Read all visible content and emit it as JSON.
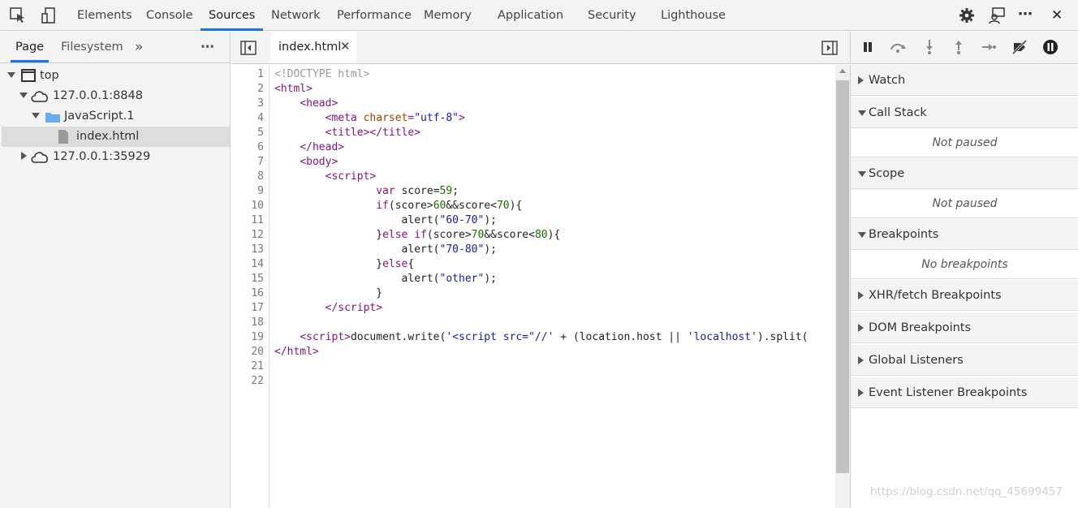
{
  "toolbar": {
    "tabs": [
      {
        "label": "Elements"
      },
      {
        "label": "Console"
      },
      {
        "label": "Sources"
      },
      {
        "label": "Network"
      },
      {
        "label": "Performance"
      },
      {
        "label": "Memory"
      },
      {
        "label": "Application"
      },
      {
        "label": "Security"
      },
      {
        "label": "Lighthouse"
      }
    ],
    "active_tab": "Sources",
    "more_label": "⋯",
    "close_label": "✕"
  },
  "navigator": {
    "tabs": [
      {
        "label": "Page"
      },
      {
        "label": "Filesystem"
      }
    ],
    "overflow_label": "»",
    "menu_label": "⋯",
    "tree": [
      {
        "label": "top",
        "icon": "frame-icon",
        "expanded": true
      },
      {
        "label": "127.0.0.1:8848",
        "icon": "cloud-icon",
        "expanded": true
      },
      {
        "label": "JavaScript.1",
        "icon": "folder-icon",
        "expanded": true
      },
      {
        "label": "index.html",
        "icon": "file-icon",
        "selected": true
      },
      {
        "label": "127.0.0.1:35929",
        "icon": "cloud-icon",
        "expanded": false
      }
    ]
  },
  "editor": {
    "open_file": "index.html",
    "close_glyph": "✕",
    "line_numbers": [
      "1",
      "2",
      "3",
      "4",
      "5",
      "6",
      "7",
      "8",
      "9",
      "10",
      "11",
      "12",
      "13",
      "14",
      "15",
      "16",
      "17",
      "18",
      "19",
      "20",
      "21",
      "22"
    ]
  },
  "debugger": {
    "sections": [
      {
        "title": "Watch",
        "expanded": false
      },
      {
        "title": "Call Stack",
        "expanded": true,
        "body": "Not paused"
      },
      {
        "title": "Scope",
        "expanded": true,
        "body": "Not paused"
      },
      {
        "title": "Breakpoints",
        "expanded": true,
        "body": "No breakpoints"
      },
      {
        "title": "XHR/fetch Breakpoints",
        "expanded": false
      },
      {
        "title": "DOM Breakpoints",
        "expanded": false
      },
      {
        "title": "Global Listeners",
        "expanded": false
      },
      {
        "title": "Event Listener Breakpoints",
        "expanded": false
      }
    ]
  },
  "watermark": "https://blog.csdn.net/qq_45699457",
  "colors": {
    "accent": "#1a73e8",
    "tag": "#881280",
    "string": "#1a1aa6",
    "number": "#1c6d00"
  }
}
